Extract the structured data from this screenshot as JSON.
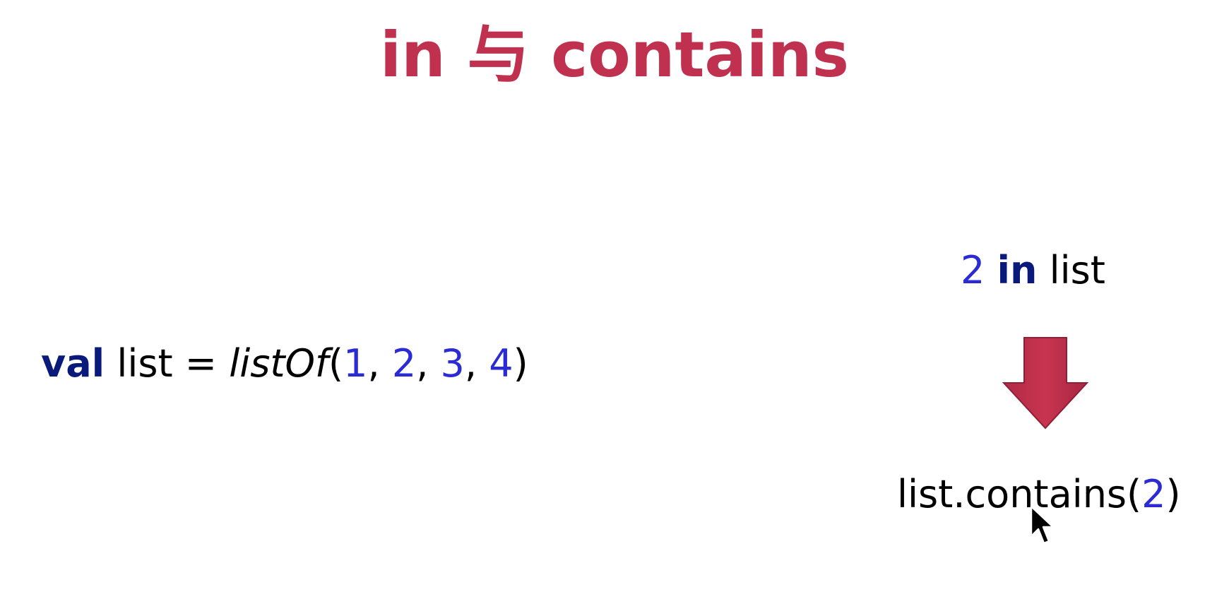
{
  "slide": {
    "title": "in 与 contains",
    "colors": {
      "title": "#c0314f",
      "keyword": "#0a1a7a",
      "number": "#2b2bd6",
      "text": "#000000",
      "arrow": "#c0314f"
    },
    "declaration": {
      "keyword": "val",
      "name": " list = ",
      "function": "listOf",
      "open_paren": "(",
      "n1": "1",
      "sep1": ", ",
      "n2": "2",
      "sep2": ", ",
      "n3": "3",
      "sep3": ", ",
      "n4": "4",
      "close_paren": ")"
    },
    "in_expression": {
      "number": "2",
      "space1": " ",
      "keyword": "in",
      "rest": " list"
    },
    "arrow_icon": "down-arrow-icon",
    "contains_expression": {
      "receiver": "list.contains(",
      "number": "2",
      "close_paren": ")"
    },
    "cursor_icon": "mouse-pointer-icon"
  }
}
